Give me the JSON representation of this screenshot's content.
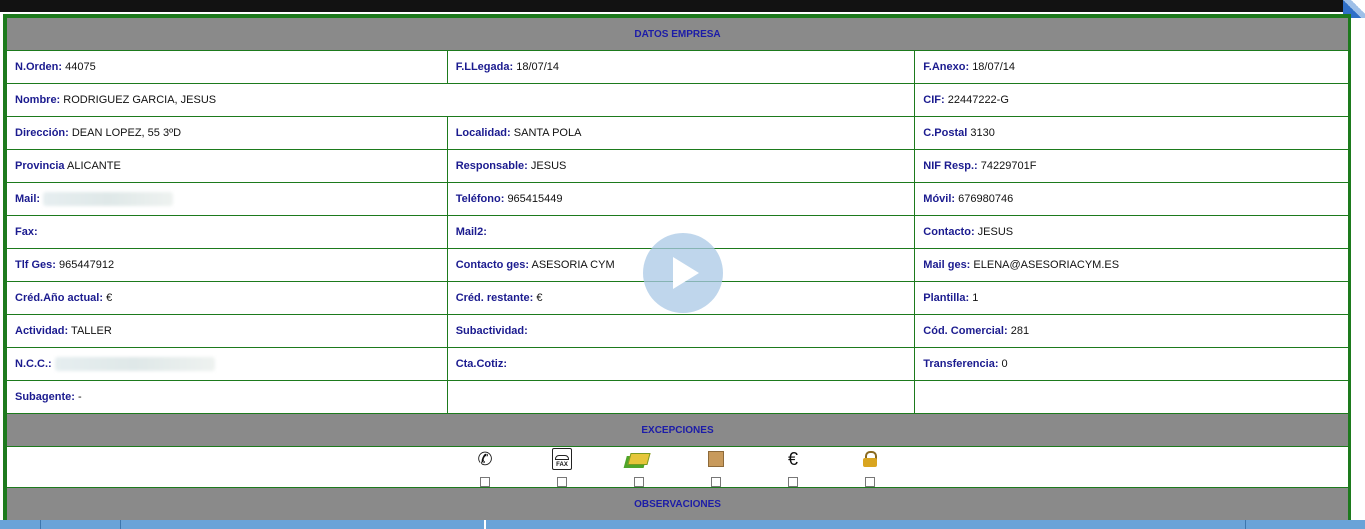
{
  "datos_empresa": {
    "header": "DATOS EMPRESA",
    "rows": [
      [
        {
          "label": "N.Orden:",
          "value": "44075"
        },
        {
          "label": "F.LLegada:",
          "value": "18/07/14"
        },
        {
          "label": "F.Anexo:",
          "value": "18/07/14"
        }
      ],
      [
        {
          "label": "Nombre:",
          "value": "RODRIGUEZ GARCIA, JESUS"
        },
        {
          "label": "CIF:",
          "value": "22447222-G"
        }
      ],
      [
        {
          "label": "Dirección:",
          "value": "DEAN LOPEZ, 55 3ºD"
        },
        {
          "label": "Localidad:",
          "value": "SANTA POLA"
        },
        {
          "label": "C.Postal",
          "value": "3130"
        }
      ],
      [
        {
          "label": "Provincia",
          "value": "ALICANTE"
        },
        {
          "label": "Responsable:",
          "value": "JESUS"
        },
        {
          "label": "NIF Resp.:",
          "value": "74229701F"
        }
      ],
      [
        {
          "label": "Mail:",
          "value": ""
        },
        {
          "label": "Teléfono:",
          "value": "965415449"
        },
        {
          "label": "Móvil:",
          "value": "676980746"
        }
      ],
      [
        {
          "label": "Fax:",
          "value": ""
        },
        {
          "label": "Mail2:",
          "value": ""
        },
        {
          "label": "Contacto:",
          "value": "JESUS"
        }
      ],
      [
        {
          "label": "Tlf Ges:",
          "value": "965447912"
        },
        {
          "label": "Contacto ges:",
          "value": "ASESORIA CYM"
        },
        {
          "label": "Mail ges:",
          "value": "ELENA@ASESORIACYM.ES"
        }
      ],
      [
        {
          "label": "Créd.Año actual:",
          "value": "€"
        },
        {
          "label": "Créd. restante:",
          "value": "€"
        },
        {
          "label": "Plantilla:",
          "value": "1"
        }
      ],
      [
        {
          "label": "Actividad:",
          "value": "TALLER"
        },
        {
          "label": "Subactividad:",
          "value": ""
        },
        {
          "label": "Cód. Comercial:",
          "value": "281"
        }
      ],
      [
        {
          "label": "N.C.C.:",
          "value": ""
        },
        {
          "label": "Cta.Cotiz:",
          "value": ""
        },
        {
          "label": "Transferencia:",
          "value": "0"
        }
      ],
      [
        {
          "label": "Subagente:",
          "value": "-"
        }
      ]
    ]
  },
  "excepciones": {
    "header": "EXCEPCIONES",
    "items": [
      {
        "icon": "phone-icon",
        "glyph": "✆"
      },
      {
        "icon": "fax-icon",
        "glyph": "FAX"
      },
      {
        "icon": "money-icon",
        "glyph": ""
      },
      {
        "icon": "box-icon",
        "glyph": ""
      },
      {
        "icon": "euro-icon",
        "glyph": "€"
      },
      {
        "icon": "lock-icon",
        "glyph": ""
      }
    ]
  },
  "observaciones": {
    "header": "OBSERVACIONES"
  },
  "colors": {
    "border": "#1d7a1d",
    "section_bg": "#8a8a8a",
    "label": "#1b1b8f"
  }
}
